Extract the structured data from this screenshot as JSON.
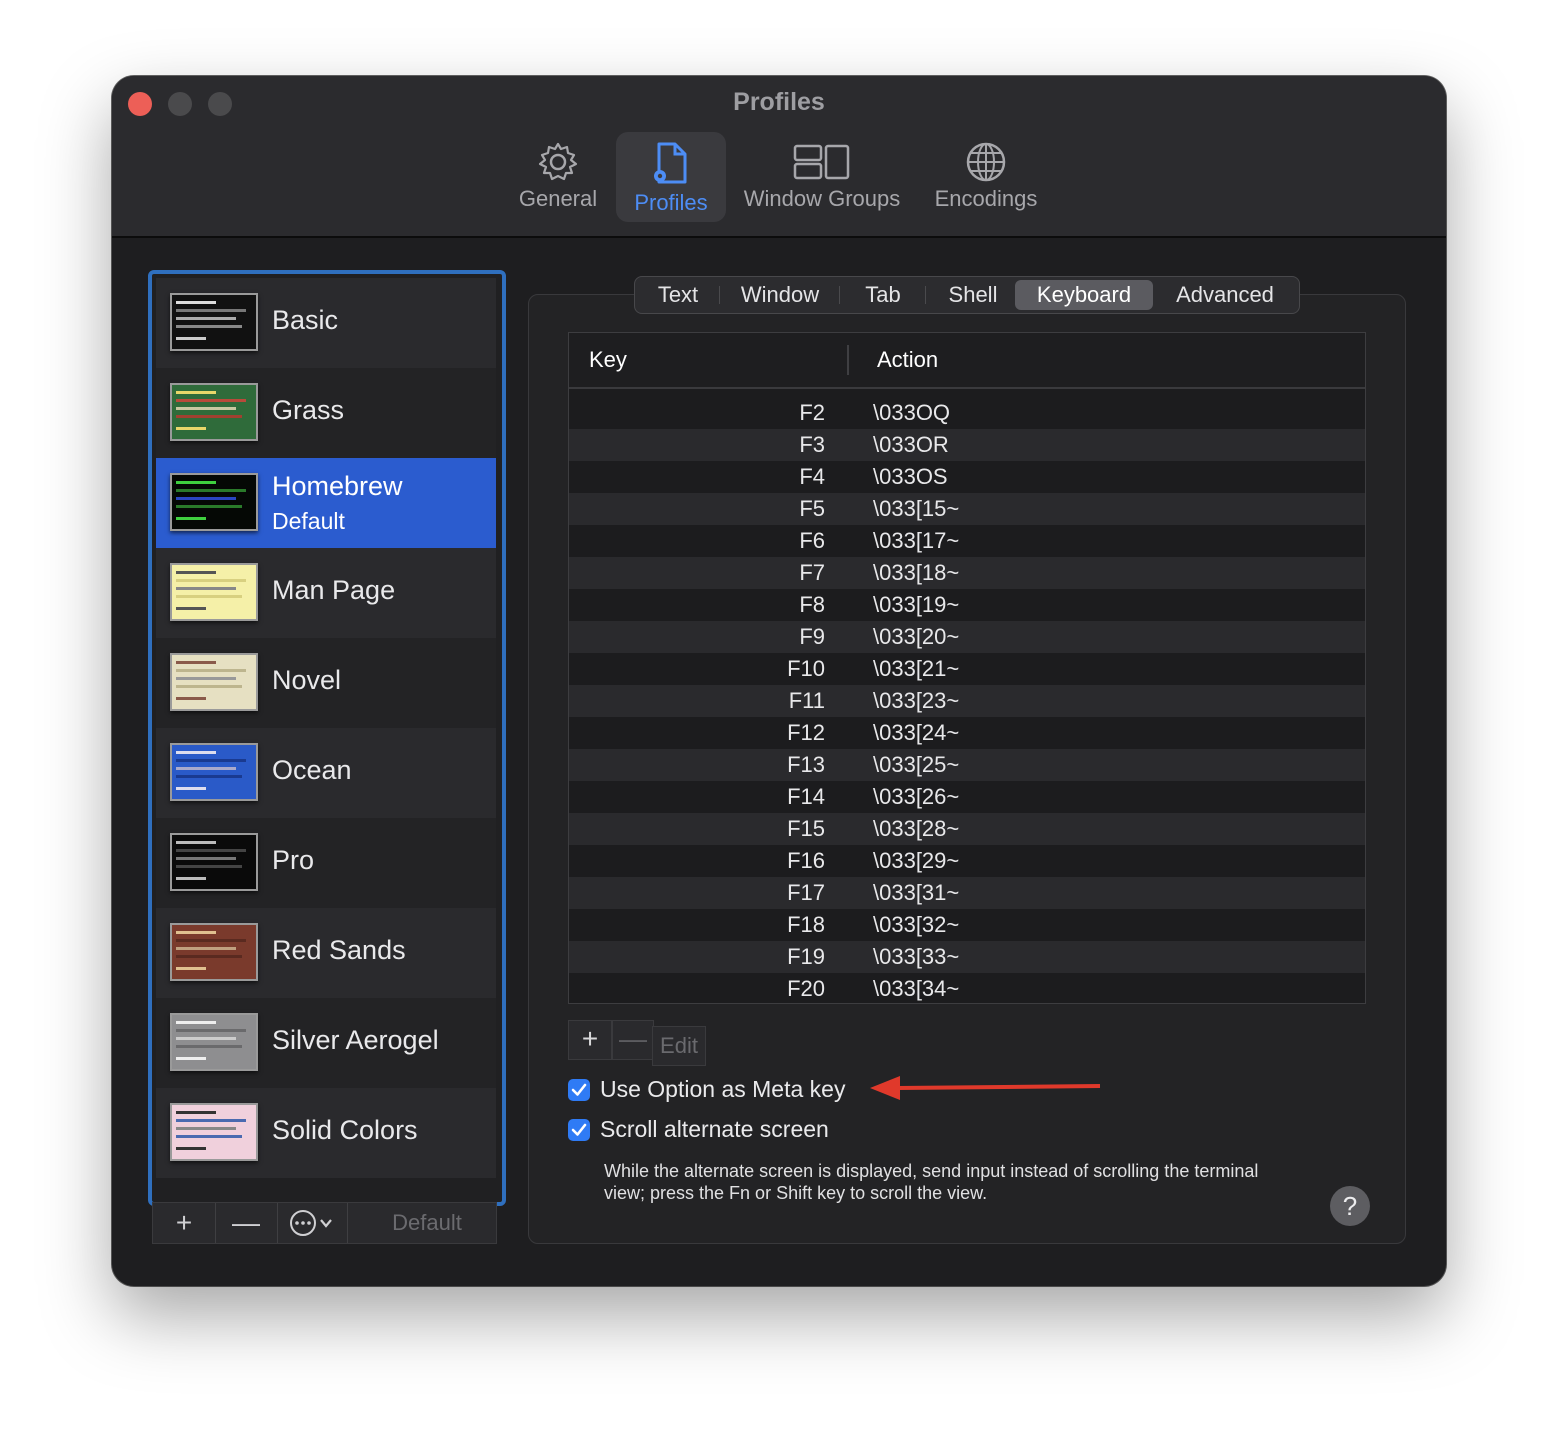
{
  "window": {
    "title": "Profiles"
  },
  "toolbar": {
    "items": [
      {
        "label": "General",
        "icon": "gear-icon"
      },
      {
        "label": "Profiles",
        "icon": "profile-doc-icon",
        "active": true
      },
      {
        "label": "Window Groups",
        "icon": "window-groups-icon"
      },
      {
        "label": "Encodings",
        "icon": "globe-icon"
      }
    ]
  },
  "profiles": {
    "items": [
      {
        "name": "Basic"
      },
      {
        "name": "Grass"
      },
      {
        "name": "Homebrew",
        "subtitle": "Default",
        "selected": true
      },
      {
        "name": "Man Page"
      },
      {
        "name": "Novel"
      },
      {
        "name": "Ocean"
      },
      {
        "name": "Pro"
      },
      {
        "name": "Red Sands"
      },
      {
        "name": "Silver Aerogel"
      },
      {
        "name": "Solid Colors"
      }
    ],
    "buttons": {
      "add": "+",
      "remove": "—",
      "more": "⋯",
      "default_label": "Default"
    }
  },
  "settings_tabs": {
    "items": [
      "Text",
      "Window",
      "Tab",
      "Shell",
      "Keyboard",
      "Advanced"
    ],
    "active": "Keyboard"
  },
  "key_table": {
    "columns": {
      "key": "Key",
      "action": "Action"
    },
    "rows": [
      {
        "key": "F2",
        "action": "\\033OQ"
      },
      {
        "key": "F3",
        "action": "\\033OR"
      },
      {
        "key": "F4",
        "action": "\\033OS"
      },
      {
        "key": "F5",
        "action": "\\033[15~"
      },
      {
        "key": "F6",
        "action": "\\033[17~"
      },
      {
        "key": "F7",
        "action": "\\033[18~"
      },
      {
        "key": "F8",
        "action": "\\033[19~"
      },
      {
        "key": "F9",
        "action": "\\033[20~"
      },
      {
        "key": "F10",
        "action": "\\033[21~"
      },
      {
        "key": "F11",
        "action": "\\033[23~"
      },
      {
        "key": "F12",
        "action": "\\033[24~"
      },
      {
        "key": "F13",
        "action": "\\033[25~"
      },
      {
        "key": "F14",
        "action": "\\033[26~"
      },
      {
        "key": "F15",
        "action": "\\033[28~"
      },
      {
        "key": "F16",
        "action": "\\033[29~"
      },
      {
        "key": "F17",
        "action": "\\033[31~"
      },
      {
        "key": "F18",
        "action": "\\033[32~"
      },
      {
        "key": "F19",
        "action": "\\033[33~"
      },
      {
        "key": "F20",
        "action": "\\033[34~"
      }
    ],
    "buttons": {
      "add": "+",
      "remove": "—",
      "edit": "Edit"
    }
  },
  "options": {
    "use_option_as_meta": {
      "label": "Use Option as Meta key",
      "checked": true
    },
    "scroll_alternate_screen": {
      "label": "Scroll alternate screen",
      "checked": true
    },
    "help_text": "While the alternate screen is displayed, send input instead of scrolling the terminal view; press the Fn or Shift key to scroll the view.",
    "help_button": "?"
  },
  "colors": {
    "accent": "#2f7bf5",
    "selection": "#2b5ccf",
    "annotation_arrow": "#e0392b"
  }
}
